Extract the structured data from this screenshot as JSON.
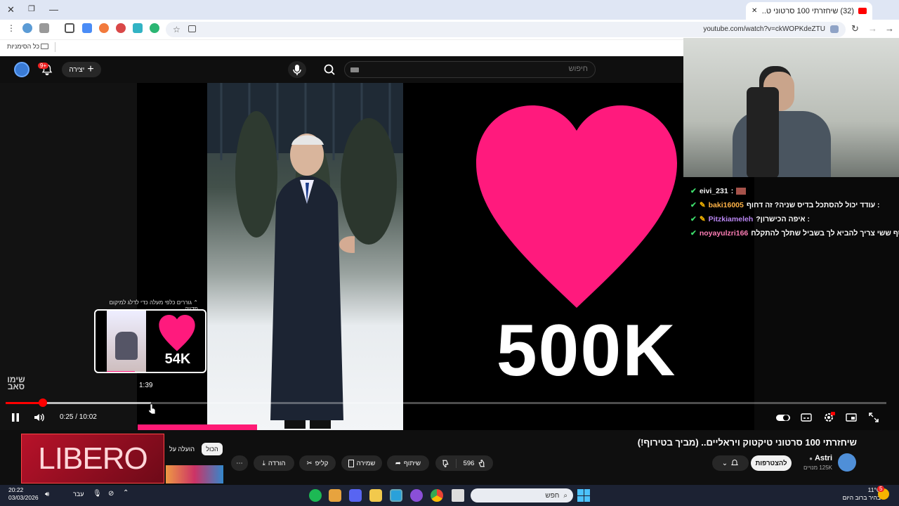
{
  "browser": {
    "tab_title": "(32) שיחזרתי 100 סרטוני ט...",
    "url": "youtube.com/watch?v=ckWOPKdeZTU",
    "bookmarks_label": "כל הסימניות"
  },
  "youtube_header": {
    "search_placeholder": "חיפוש",
    "create_label": "יצירה",
    "notifications_badge": "9+"
  },
  "video": {
    "big_count": "500K",
    "watermark": "שימו סאב",
    "preview_hint": "גוררים כלפי מעלה כדי לדלג למיקום מדויק",
    "preview_time": "1:39",
    "preview_count": "54K",
    "current_time": "0:25 / 10:02",
    "progress": {
      "played_fraction": 0.042,
      "buffered_fraction": 0.165
    }
  },
  "chat": {
    "messages": [
      {
        "user": "eivi_231",
        "text": "",
        "user_color": "#f3f3f3"
      },
      {
        "user": "baki16005",
        "text": ": עודד יכול להסתכל בדיס שניה? זה דחוף",
        "user_color": "#ffb347"
      },
      {
        "user": "Pitzkiameleh",
        "text": ": איפה הכישרון?",
        "user_color": "#b986f2"
      },
      {
        "user": "noyayulzri166",
        "text": ": כסף ששי צריך להביא לך בשביל שתלך להתקלח",
        "user_color": "#ff7eb6"
      }
    ]
  },
  "below_video": {
    "title": "שיחזרתי 100 סרטוני טיקטוק ויראליים.. (מביך בטירוף!)",
    "channel_name": "Astri",
    "subscribers": "125K מנויים",
    "subscribe_label": "להצטרפות",
    "like_count": "596",
    "share_label": "שיתוף",
    "save_label": "שמירה",
    "clip_label": "קליפ",
    "download_label": "הורדה",
    "chip_all": "הכול",
    "chip_uploaded": "הועלה על",
    "ad_brand": "LIBERO"
  },
  "taskbar": {
    "search_label": "חפש",
    "time": "20:22",
    "date": "03/03/2026",
    "language": "עבר",
    "weather_temp": "11°C",
    "weather_desc": "בהיר ברוב היום",
    "notification_count": "5"
  }
}
